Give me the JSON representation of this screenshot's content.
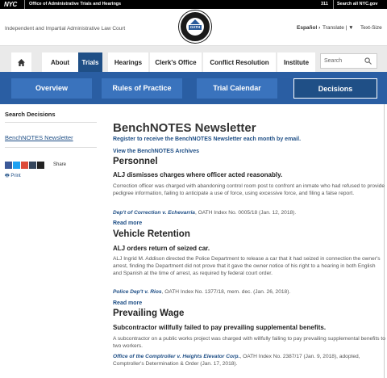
{
  "topbar": {
    "logo": "NYC",
    "office": "Office of Administrative Trials and Hearings",
    "phone": "311",
    "search_all": "Search all NYC.gov websites"
  },
  "header": {
    "tagline": "Independent and Impartial Administrative Law Court",
    "seal_text": "OATH",
    "espanol": "Español",
    "translate": "Translate",
    "text_size": "Text-Size"
  },
  "nav": {
    "items": [
      "About",
      "Trials",
      "Hearings",
      "Clerk's Office",
      "Conflict Resolution",
      "Institute"
    ],
    "active": "Trials",
    "search_placeholder": "Search"
  },
  "bluebar": {
    "items": [
      "Overview",
      "Rules of Practice",
      "Trial Calendar",
      "Decisions"
    ],
    "active": "Decisions"
  },
  "sidebar": {
    "title": "Search Decisions",
    "link": "BenchNOTES Newsletter",
    "share_label": "Share",
    "print_label": "Print"
  },
  "main": {
    "title": "BenchNOTES Newsletter",
    "register_link": "Register to receive the BenchNOTES Newsletter each month by email.",
    "archives_link": "View the BenchNOTES Archives",
    "read_more": "Read more",
    "sections": [
      {
        "heading": "Personnel",
        "subheading": "ALJ dismisses charges where officer acted reasonably.",
        "body": "Correction officer was charged with abandoning control room post to confront an inmate who had refused to provide pedigree information, failing to anticipate a use of force, using excessive force, and filing a false report.",
        "case": "Dep't of Correction v. Echevarria",
        "cite": ", OATH Index No. 0005/18 (Jan. 12, 2018)."
      },
      {
        "heading": "Vehicle Retention",
        "subheading": "ALJ orders return of seized car.",
        "body": "ALJ Ingrid M. Addison directed the Police Department to release a car that it had seized in connection the owner's arrest, finding the Department did not prove that it gave the owner notice of his right to a hearing in both English and Spanish at the time of arrest, as required by federal court order.",
        "case": "Police Dep't v. Rios",
        "cite": ", OATH Index No. 1377/18, mem. dec. (Jan. 26, 2018)."
      },
      {
        "heading": "Prevailing Wage",
        "subheading": "Subcontractor willfully failed to pay prevailing supplemental benefits.",
        "body": "A subcontractor on a public works project was charged with willfully failing to pay prevailing supplemental benefits to two workers.",
        "case": "Office of the Comptroller v. Heights Elevator Corp.",
        "cite": ", OATH Index No. 2387/17 (Jan. 9, 2018), adopted, Comptroller's Determination & Order (Jan. 17, 2018)."
      }
    ]
  }
}
